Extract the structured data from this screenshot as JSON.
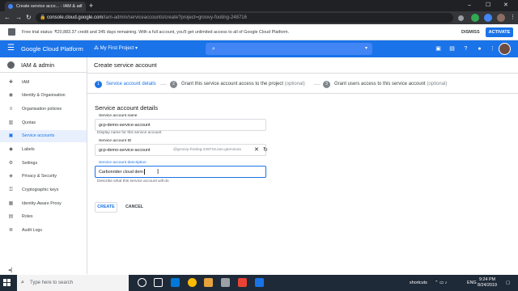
{
  "browser": {
    "tab_title": "Create service acco... - IAM & ad",
    "tab_close": "×",
    "new_tab": "+",
    "url_host": "console.cloud.google.com",
    "url_path": "/iam-admin/serviceaccounts/create?project=groovy-footing-248716",
    "win_min": "–",
    "win_max": "☐",
    "win_close": "✕"
  },
  "banner": {
    "text": "Free trial status: ₹20,883.37 credit and 345 days remaining. With a full account, you'll get unlimited access to all of Google Cloud Platform.",
    "dismiss": "DISMISS",
    "activate": "ACTIVATE"
  },
  "topbar": {
    "title": "Google Cloud Platform",
    "project": "My First Project",
    "project_caret": "▾",
    "search_caret": "▾"
  },
  "sidebar": {
    "title": "IAM & admin",
    "items": [
      {
        "label": "IAM",
        "icon": "person-add-icon"
      },
      {
        "label": "Identity & Organisation",
        "icon": "account-circle-icon"
      },
      {
        "label": "Organisation policies",
        "icon": "list-icon"
      },
      {
        "label": "Quotas",
        "icon": "quota-icon"
      },
      {
        "label": "Service accounts",
        "icon": "service-account-icon",
        "active": true
      },
      {
        "label": "Labels",
        "icon": "label-icon"
      },
      {
        "label": "Settings",
        "icon": "gear-icon"
      },
      {
        "label": "Privacy & Security",
        "icon": "shield-icon"
      },
      {
        "label": "Cryptographic keys",
        "icon": "key-icon"
      },
      {
        "label": "Identity-Aware Proxy",
        "icon": "proxy-icon"
      },
      {
        "label": "Roles",
        "icon": "roles-icon"
      },
      {
        "label": "Audit Logs",
        "icon": "audit-log-icon"
      }
    ],
    "collapse_glyph": "◂|"
  },
  "main": {
    "title": "Create service account",
    "steps": [
      {
        "num": "1",
        "label": "Service account details",
        "optional": ""
      },
      {
        "num": "2",
        "label": "Grant this service account access to the project",
        "optional": "(optional)"
      },
      {
        "num": "3",
        "label": "Grant users access to this service account",
        "optional": "(optional)"
      }
    ],
    "section_title": "Service account details",
    "name_field": {
      "label": "Service account name",
      "value": "gcp-demo-service-account",
      "hint": "Display name for this service account"
    },
    "id_field": {
      "label": "Service account ID",
      "value": "gcp-demo-service-account",
      "suffix": "@groovy-footing-248716.iam.gservicea"
    },
    "desc_field": {
      "label": "Service account description",
      "value": "Carbonrider cloud dem",
      "hint": "Describe what this service account will do"
    },
    "create": "CREATE",
    "cancel": "CANCEL"
  },
  "taskbar": {
    "search_placeholder": "Type here to search",
    "shortcuts": "shortcuts",
    "lang": "ENG",
    "time": "9:24 PM",
    "date": "8/24/2019"
  },
  "colors": {
    "accent": "#1a73e8",
    "taskbar": "#1f2a38"
  }
}
